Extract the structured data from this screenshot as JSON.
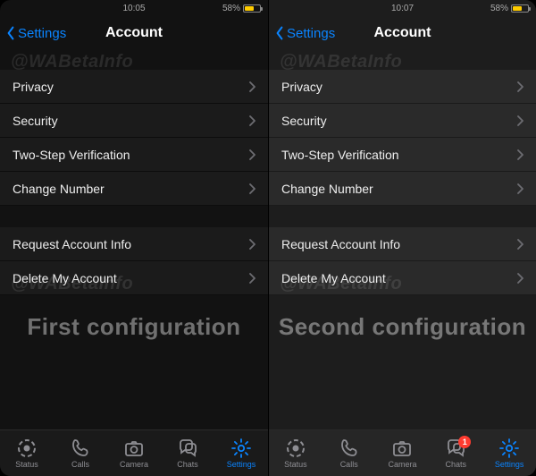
{
  "panes": [
    {
      "status": {
        "time": "10:05",
        "battery_pct": "58%"
      },
      "nav": {
        "back": "Settings",
        "title": "Account"
      },
      "watermark": "@WABetaInfo",
      "group1": [
        {
          "label": "Privacy"
        },
        {
          "label": "Security"
        },
        {
          "label": "Two-Step Verification"
        },
        {
          "label": "Change Number"
        }
      ],
      "group2": [
        {
          "label": "Request Account Info"
        },
        {
          "label": "Delete My Account"
        }
      ],
      "overlay_text": "First configuration",
      "tabs": {
        "status": "Status",
        "calls": "Calls",
        "camera": "Camera",
        "chats": "Chats",
        "settings": "Settings",
        "active": "settings",
        "chats_badge": ""
      }
    },
    {
      "status": {
        "time": "10:07",
        "battery_pct": "58%"
      },
      "nav": {
        "back": "Settings",
        "title": "Account"
      },
      "watermark": "@WABetaInfo",
      "group1": [
        {
          "label": "Privacy"
        },
        {
          "label": "Security"
        },
        {
          "label": "Two-Step Verification"
        },
        {
          "label": "Change Number"
        }
      ],
      "group2": [
        {
          "label": "Request Account Info"
        },
        {
          "label": "Delete My Account"
        }
      ],
      "overlay_text": "Second configuration",
      "tabs": {
        "status": "Status",
        "calls": "Calls",
        "camera": "Camera",
        "chats": "Chats",
        "settings": "Settings",
        "active": "settings",
        "chats_badge": "1"
      }
    }
  ]
}
